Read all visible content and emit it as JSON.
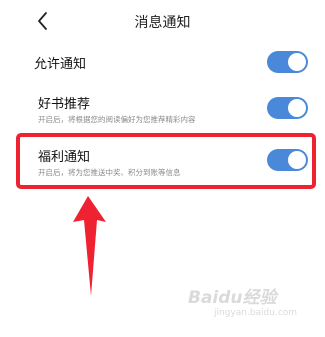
{
  "header": {
    "title": "消息通知",
    "back_icon": "chevron-left-icon"
  },
  "settings": [
    {
      "title": "允许通知",
      "subtitle": "",
      "enabled": true
    },
    {
      "title": "好书推荐",
      "subtitle": "开启后，将根据您的阅读偏好为您推荐精彩内容",
      "enabled": true
    },
    {
      "title": "福利通知",
      "subtitle": "开启后，将为您推送中奖、积分到账等信息",
      "enabled": true
    }
  ],
  "annotation": {
    "highlight_color": "#ee2230",
    "arrow_color": "#ee2230"
  },
  "watermark": {
    "brand": "Baidu经验",
    "url": "jingyan.baidu.com"
  },
  "colors": {
    "toggle_on": "#4a88d9",
    "background": "#ffffff",
    "subtitle": "#8a8a8a"
  }
}
